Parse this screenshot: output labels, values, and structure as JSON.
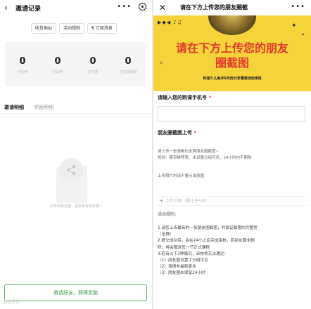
{
  "left": {
    "nav_title": "邀请记录",
    "actions": [
      "收货地址",
      "活动规则",
      "订阅消息"
    ],
    "stats": [
      {
        "value": "0",
        "label": "已注册"
      },
      {
        "value": "0",
        "label": "已试听"
      },
      {
        "value": "0",
        "label": "已付费"
      },
      {
        "value": "0",
        "label": "已过退费期"
      }
    ],
    "tabs": [
      "邀请明细",
      "奖励明细"
    ],
    "empty_text": "分享到朋友圈，更容易有收获哦~",
    "invite_button": "邀请好友，获得奖励",
    "watermark": "@值得买"
  },
  "right": {
    "nav_title": "请在下方上传您的朋友圈截",
    "banner": {
      "headline_1": "请在下方上传您的朋友",
      "headline_2": "圈截图",
      "subtitle": "有道少儿美术6月份分享赠课活动审核",
      "accent": "#f6d33a",
      "headline_color": "#e33a2d"
    },
    "phone_label": "请输入您的购课手机号",
    "phone_value": "",
    "upload_section_label": "朋友圈截图上传",
    "desc_1": "请上传一张清晰的全屏朋友圈截图~",
    "desc_2": "规则：需带推荐语、未设置分组可见、24小时内不删除",
    "note": "上传照片时请不要点击原图",
    "upload_placeholder": "上传文件（需小于5M）",
    "rules_title": "活动规则：",
    "rules": [
      "1.请您上传最新的一张朋友圈截图，并保证截图的完整性",
      "（全屏）",
      "2.提交成功后，会在24小之后完成审核，若朋友圈未删",
      "除，将会赠送您一节正式课程",
      "3.若有以下3种情况，审核将无法通过：",
      "（1）朋友圈设置了分组可见",
      "（2）海报非最新版本",
      "（3）朋友圈未保留24小时"
    ]
  }
}
